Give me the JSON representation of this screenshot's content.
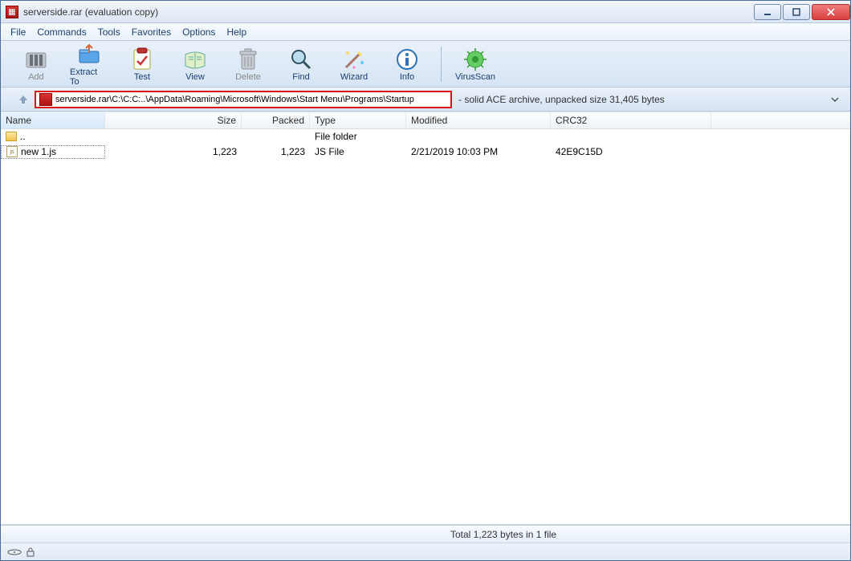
{
  "title": "serverside.rar (evaluation copy)",
  "menu": [
    "File",
    "Commands",
    "Tools",
    "Favorites",
    "Options",
    "Help"
  ],
  "toolbar": [
    {
      "label": "Add",
      "disabled": true
    },
    {
      "label": "Extract To",
      "disabled": false
    },
    {
      "label": "Test",
      "disabled": false
    },
    {
      "label": "View",
      "disabled": false
    },
    {
      "label": "Delete",
      "disabled": true
    },
    {
      "label": "Find",
      "disabled": false
    },
    {
      "label": "Wizard",
      "disabled": false
    },
    {
      "label": "Info",
      "disabled": false
    },
    {
      "label": "VirusScan",
      "disabled": false
    }
  ],
  "address": {
    "path": "serverside.rar\\C:\\C:C:..\\AppData\\Roaming\\Microsoft\\Windows\\Start Menu\\Programs\\Startup",
    "info": "- solid ACE archive, unpacked size 31,405 bytes"
  },
  "columns": [
    "Name",
    "Size",
    "Packed",
    "Type",
    "Modified",
    "CRC32"
  ],
  "rows": [
    {
      "kind": "folder",
      "name": "..",
      "size": "",
      "packed": "",
      "type": "File folder",
      "modified": "",
      "crc": ""
    },
    {
      "kind": "file",
      "name": "new 1.js",
      "size": "1,223",
      "packed": "1,223",
      "type": "JS File",
      "modified": "2/21/2019 10:03 PM",
      "crc": "42E9C15D"
    }
  ],
  "bottom_status": "Total 1,223 bytes in 1 file"
}
